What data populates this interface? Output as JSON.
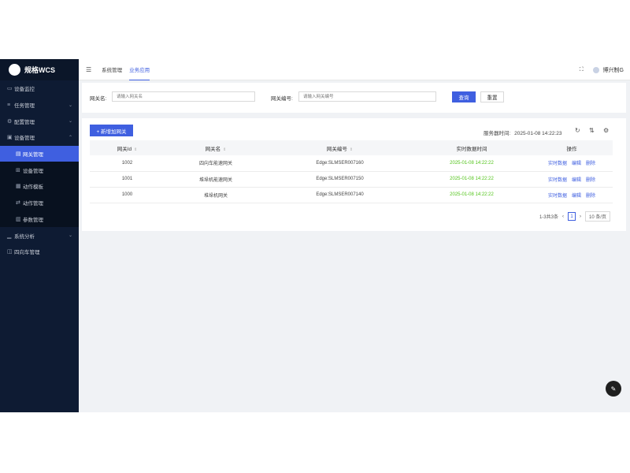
{
  "sidebar": {
    "logo_text": "",
    "brand": "规格WCS",
    "items": [
      {
        "icon": "monitor-icon",
        "label": "设备监控",
        "expandable": false
      },
      {
        "icon": "list-icon",
        "label": "任务管理",
        "expandable": true
      },
      {
        "icon": "gear-icon",
        "label": "配置管理",
        "expandable": true
      },
      {
        "icon": "device-icon",
        "label": "设备管理",
        "expandable": true,
        "expanded": true
      },
      {
        "icon": "gateway-icon",
        "label": "网关管理",
        "sub": true,
        "active": true
      },
      {
        "icon": "grid-icon",
        "label": "设备管理",
        "sub": true
      },
      {
        "icon": "template-icon",
        "label": "动作模板",
        "sub": true
      },
      {
        "icon": "action-icon",
        "label": "动作管理",
        "sub": true
      },
      {
        "icon": "param-icon",
        "label": "参数管理",
        "sub": true
      },
      {
        "icon": "chart-icon",
        "label": "系统分析",
        "expandable": true
      },
      {
        "icon": "vehicle-icon",
        "label": "四向车管理",
        "expandable": false
      }
    ]
  },
  "topbar": {
    "tabs": [
      {
        "label": "系统管理",
        "active": false
      },
      {
        "label": "业务应用",
        "active": true
      }
    ],
    "user": "博兴制G"
  },
  "search": {
    "name_label": "网关名:",
    "name_placeholder": "请输入网关名",
    "code_label": "网关编号:",
    "code_placeholder": "请输入网关编号",
    "query_button": "查询",
    "reset_button": "重置"
  },
  "table": {
    "add_button": "+ 新增加网关",
    "server_time_label": "服务器时间:",
    "server_time": "2025-01-08 14:22:23",
    "columns": [
      "网关Id",
      "网关名",
      "网关编号",
      "实时数据时间",
      "操作"
    ],
    "rows": [
      {
        "id": "1002",
        "name": "四向车能速网关",
        "code": "Edge:SLMSER007160",
        "time": "2025-01-08 14:22:22"
      },
      {
        "id": "1001",
        "name": "堆垛机能速网关",
        "code": "Edge:SLMSER007150",
        "time": "2025-01-08 14:22:22"
      },
      {
        "id": "1000",
        "name": "堆垛机网关",
        "code": "Edge:SLMSER007140",
        "time": "2025-01-08 14:22:22"
      }
    ],
    "actions": [
      "实时数据",
      "编辑",
      "删除"
    ],
    "pagination": {
      "summary": "1-3共3条",
      "current_page": "1",
      "page_size": "10 条/页"
    }
  },
  "colors": {
    "primary": "#3f5fe0",
    "sidebar_bg": "#0e1b33",
    "time_green": "#52c41a"
  }
}
